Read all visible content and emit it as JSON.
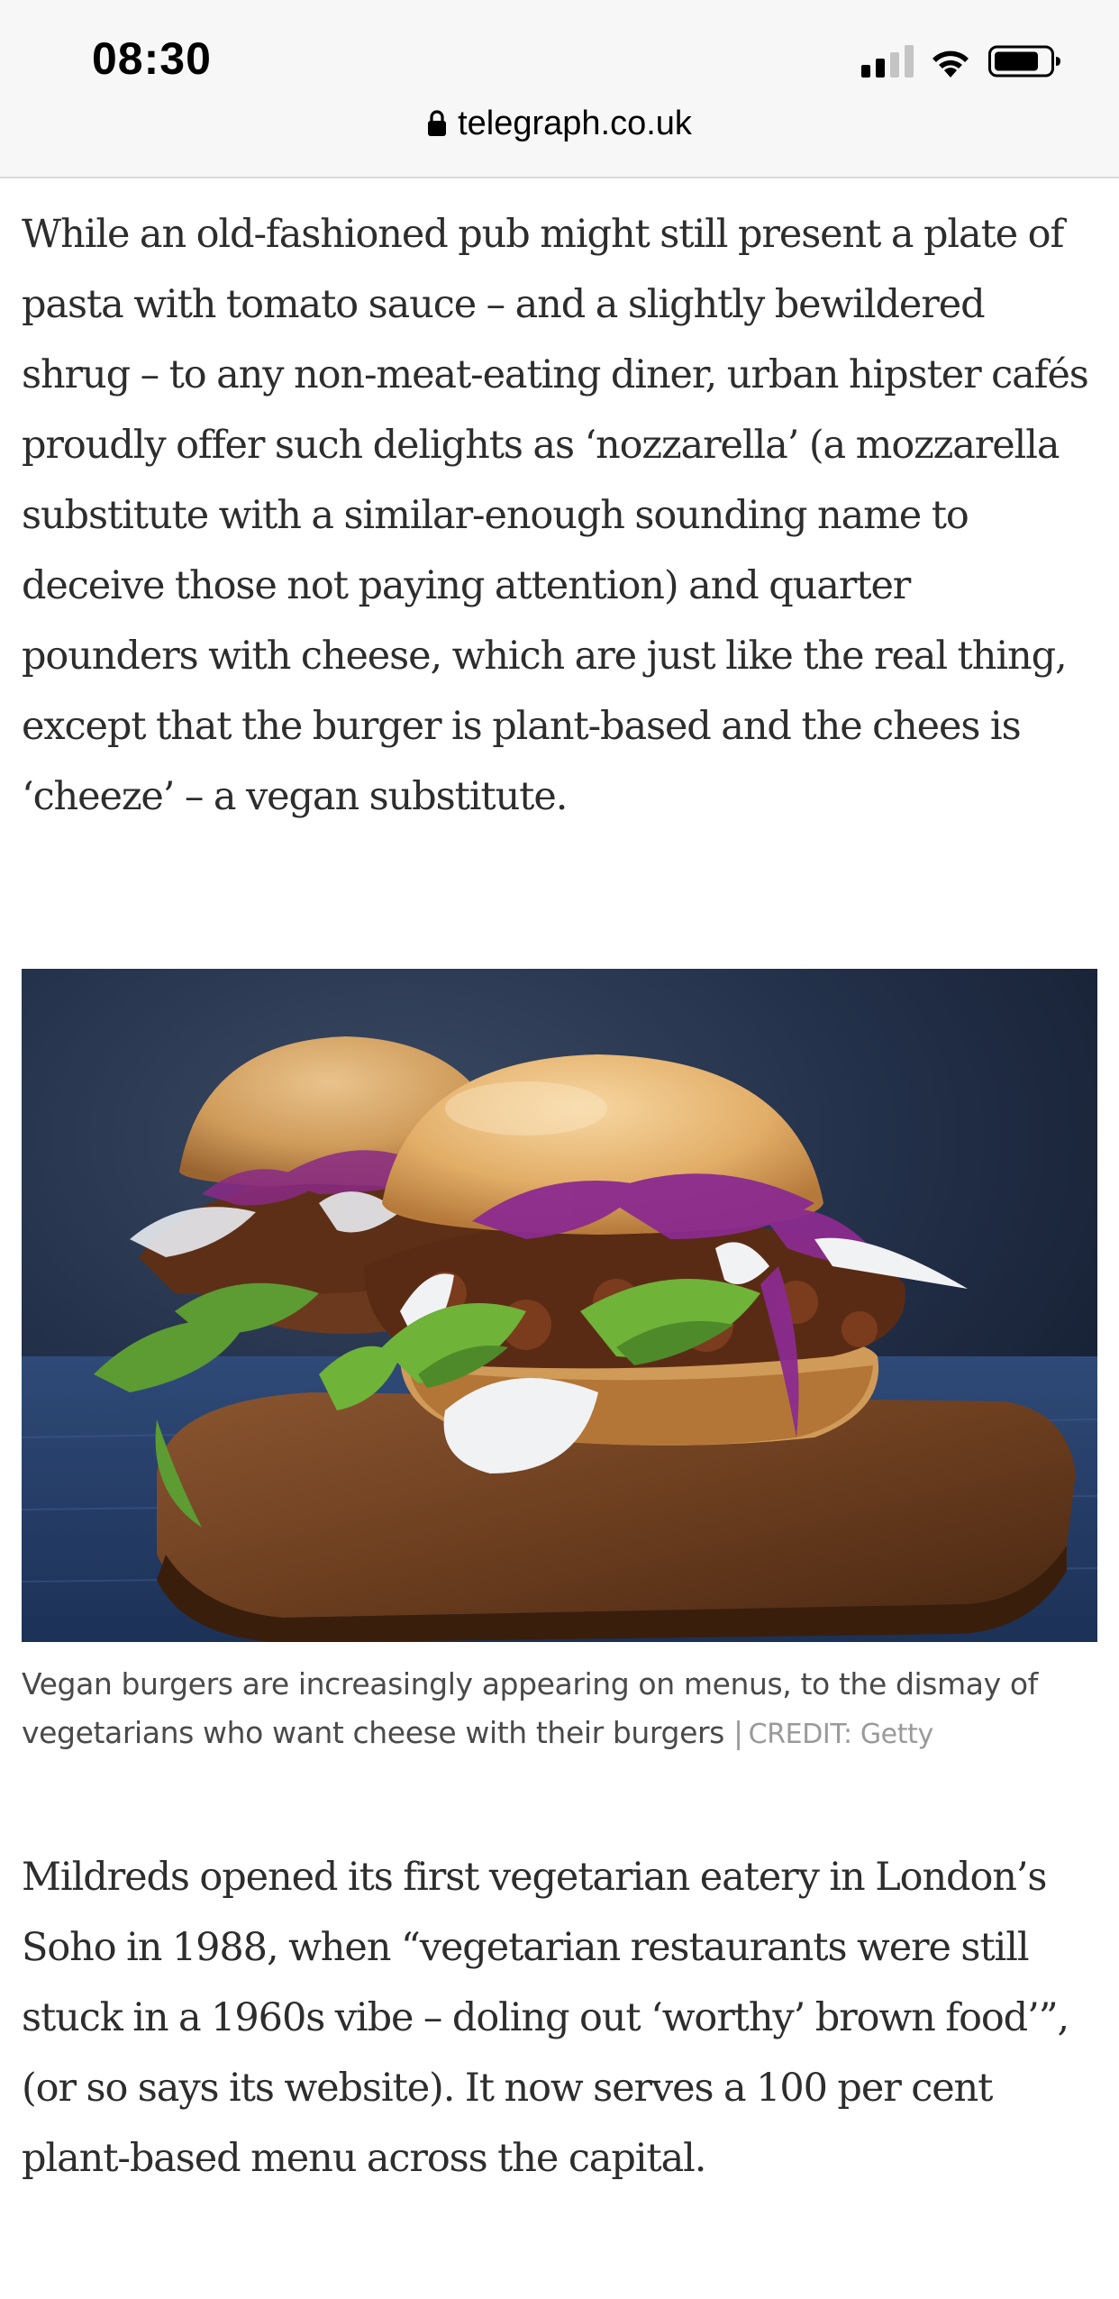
{
  "status_bar": {
    "time": "08:30",
    "icons": [
      "cellular-signal-icon",
      "wifi-icon",
      "battery-icon"
    ]
  },
  "browser": {
    "url": "telegraph.co.uk",
    "lock_icon": "lock-icon"
  },
  "article": {
    "paragraphs": [
      "While an old-fashioned pub might still present a plate of pasta with tomato sauce – and a slightly bewildered shrug – to any non-meat-eating diner, urban hipster cafés proudly offer such delights as ‘nozzarella’ (a mozzarella substitute with a similar-enough sounding name to deceive those not paying attention) and quarter pounders with cheese, which are just like the real thing, except that the burger is plant-based and the chees is ‘cheeze’ – a vegan substitute.",
      "Mildreds opened its first vegetarian eatery in London’s Soho in 1988, when “vegetarian restaurants were still stuck in a 1960s vibe – doling out ‘worthy’ brown food’”, (or so says its website). It now serves a 100 per cent plant-based menu across the capital."
    ],
    "figure": {
      "caption": "Vegan burgers are increasingly appearing on menus, to the dismay of vegetarians who want cheese with their burgers",
      "credit_separator": "|",
      "credit": "CREDIT: Getty"
    }
  },
  "colors": {
    "chrome_background": "#f7f7f7",
    "body_text": "#2d2d2d",
    "caption_text": "#4a4a4a",
    "credit_text": "#9a9a9a"
  }
}
